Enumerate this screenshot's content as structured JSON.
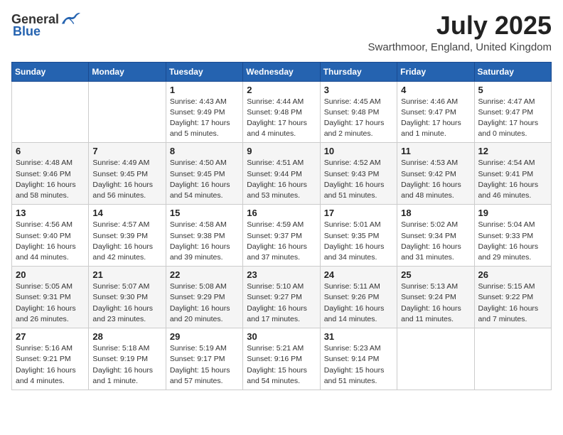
{
  "header": {
    "logo_general": "General",
    "logo_blue": "Blue",
    "month_title": "July 2025",
    "location": "Swarthmoor, England, United Kingdom"
  },
  "days_of_week": [
    "Sunday",
    "Monday",
    "Tuesday",
    "Wednesday",
    "Thursday",
    "Friday",
    "Saturday"
  ],
  "weeks": [
    [
      {
        "day": "",
        "info": ""
      },
      {
        "day": "",
        "info": ""
      },
      {
        "day": "1",
        "info": "Sunrise: 4:43 AM\nSunset: 9:49 PM\nDaylight: 17 hours\nand 5 minutes."
      },
      {
        "day": "2",
        "info": "Sunrise: 4:44 AM\nSunset: 9:48 PM\nDaylight: 17 hours\nand 4 minutes."
      },
      {
        "day": "3",
        "info": "Sunrise: 4:45 AM\nSunset: 9:48 PM\nDaylight: 17 hours\nand 2 minutes."
      },
      {
        "day": "4",
        "info": "Sunrise: 4:46 AM\nSunset: 9:47 PM\nDaylight: 17 hours\nand 1 minute."
      },
      {
        "day": "5",
        "info": "Sunrise: 4:47 AM\nSunset: 9:47 PM\nDaylight: 17 hours\nand 0 minutes."
      }
    ],
    [
      {
        "day": "6",
        "info": "Sunrise: 4:48 AM\nSunset: 9:46 PM\nDaylight: 16 hours\nand 58 minutes."
      },
      {
        "day": "7",
        "info": "Sunrise: 4:49 AM\nSunset: 9:45 PM\nDaylight: 16 hours\nand 56 minutes."
      },
      {
        "day": "8",
        "info": "Sunrise: 4:50 AM\nSunset: 9:45 PM\nDaylight: 16 hours\nand 54 minutes."
      },
      {
        "day": "9",
        "info": "Sunrise: 4:51 AM\nSunset: 9:44 PM\nDaylight: 16 hours\nand 53 minutes."
      },
      {
        "day": "10",
        "info": "Sunrise: 4:52 AM\nSunset: 9:43 PM\nDaylight: 16 hours\nand 51 minutes."
      },
      {
        "day": "11",
        "info": "Sunrise: 4:53 AM\nSunset: 9:42 PM\nDaylight: 16 hours\nand 48 minutes."
      },
      {
        "day": "12",
        "info": "Sunrise: 4:54 AM\nSunset: 9:41 PM\nDaylight: 16 hours\nand 46 minutes."
      }
    ],
    [
      {
        "day": "13",
        "info": "Sunrise: 4:56 AM\nSunset: 9:40 PM\nDaylight: 16 hours\nand 44 minutes."
      },
      {
        "day": "14",
        "info": "Sunrise: 4:57 AM\nSunset: 9:39 PM\nDaylight: 16 hours\nand 42 minutes."
      },
      {
        "day": "15",
        "info": "Sunrise: 4:58 AM\nSunset: 9:38 PM\nDaylight: 16 hours\nand 39 minutes."
      },
      {
        "day": "16",
        "info": "Sunrise: 4:59 AM\nSunset: 9:37 PM\nDaylight: 16 hours\nand 37 minutes."
      },
      {
        "day": "17",
        "info": "Sunrise: 5:01 AM\nSunset: 9:35 PM\nDaylight: 16 hours\nand 34 minutes."
      },
      {
        "day": "18",
        "info": "Sunrise: 5:02 AM\nSunset: 9:34 PM\nDaylight: 16 hours\nand 31 minutes."
      },
      {
        "day": "19",
        "info": "Sunrise: 5:04 AM\nSunset: 9:33 PM\nDaylight: 16 hours\nand 29 minutes."
      }
    ],
    [
      {
        "day": "20",
        "info": "Sunrise: 5:05 AM\nSunset: 9:31 PM\nDaylight: 16 hours\nand 26 minutes."
      },
      {
        "day": "21",
        "info": "Sunrise: 5:07 AM\nSunset: 9:30 PM\nDaylight: 16 hours\nand 23 minutes."
      },
      {
        "day": "22",
        "info": "Sunrise: 5:08 AM\nSunset: 9:29 PM\nDaylight: 16 hours\nand 20 minutes."
      },
      {
        "day": "23",
        "info": "Sunrise: 5:10 AM\nSunset: 9:27 PM\nDaylight: 16 hours\nand 17 minutes."
      },
      {
        "day": "24",
        "info": "Sunrise: 5:11 AM\nSunset: 9:26 PM\nDaylight: 16 hours\nand 14 minutes."
      },
      {
        "day": "25",
        "info": "Sunrise: 5:13 AM\nSunset: 9:24 PM\nDaylight: 16 hours\nand 11 minutes."
      },
      {
        "day": "26",
        "info": "Sunrise: 5:15 AM\nSunset: 9:22 PM\nDaylight: 16 hours\nand 7 minutes."
      }
    ],
    [
      {
        "day": "27",
        "info": "Sunrise: 5:16 AM\nSunset: 9:21 PM\nDaylight: 16 hours\nand 4 minutes."
      },
      {
        "day": "28",
        "info": "Sunrise: 5:18 AM\nSunset: 9:19 PM\nDaylight: 16 hours\nand 1 minute."
      },
      {
        "day": "29",
        "info": "Sunrise: 5:19 AM\nSunset: 9:17 PM\nDaylight: 15 hours\nand 57 minutes."
      },
      {
        "day": "30",
        "info": "Sunrise: 5:21 AM\nSunset: 9:16 PM\nDaylight: 15 hours\nand 54 minutes."
      },
      {
        "day": "31",
        "info": "Sunrise: 5:23 AM\nSunset: 9:14 PM\nDaylight: 15 hours\nand 51 minutes."
      },
      {
        "day": "",
        "info": ""
      },
      {
        "day": "",
        "info": ""
      }
    ]
  ]
}
